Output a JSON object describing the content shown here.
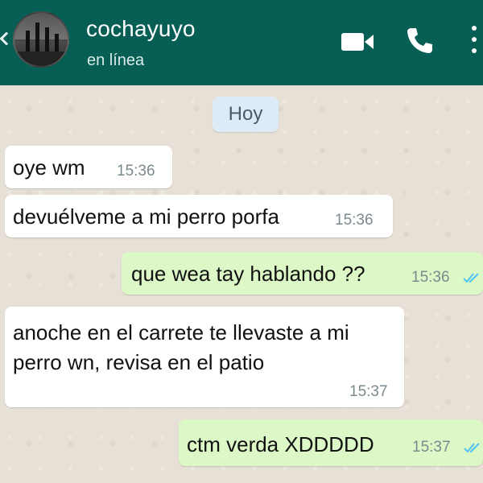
{
  "header": {
    "contact_name": "cochayuyo",
    "status": "en línea",
    "icons": [
      "back-arrow-icon",
      "video-call-icon",
      "phone-call-icon",
      "more-options-icon"
    ],
    "background_color": "#075e54"
  },
  "chat": {
    "date_label": "Hoy",
    "messages": [
      {
        "direction": "incoming",
        "text": "oye wm",
        "time": "15:36"
      },
      {
        "direction": "incoming",
        "text": "devuélveme a mi perro porfa",
        "time": "15:36"
      },
      {
        "direction": "outgoing",
        "text": "que wea tay hablando ??",
        "time": "15:36",
        "status": "read"
      },
      {
        "direction": "incoming",
        "text": "anoche en el carrete te llevaste a mi perro wn, revisa en el patio",
        "time": "15:37"
      },
      {
        "direction": "outgoing",
        "text": "ctm verda XDDDDD",
        "time": "15:37",
        "status": "read"
      }
    ]
  },
  "colors": {
    "incoming_bubble": "#ffffff",
    "outgoing_bubble": "#dcf8c6",
    "read_ticks": "#4fc3f7",
    "date_chip": "#dcebf5"
  }
}
